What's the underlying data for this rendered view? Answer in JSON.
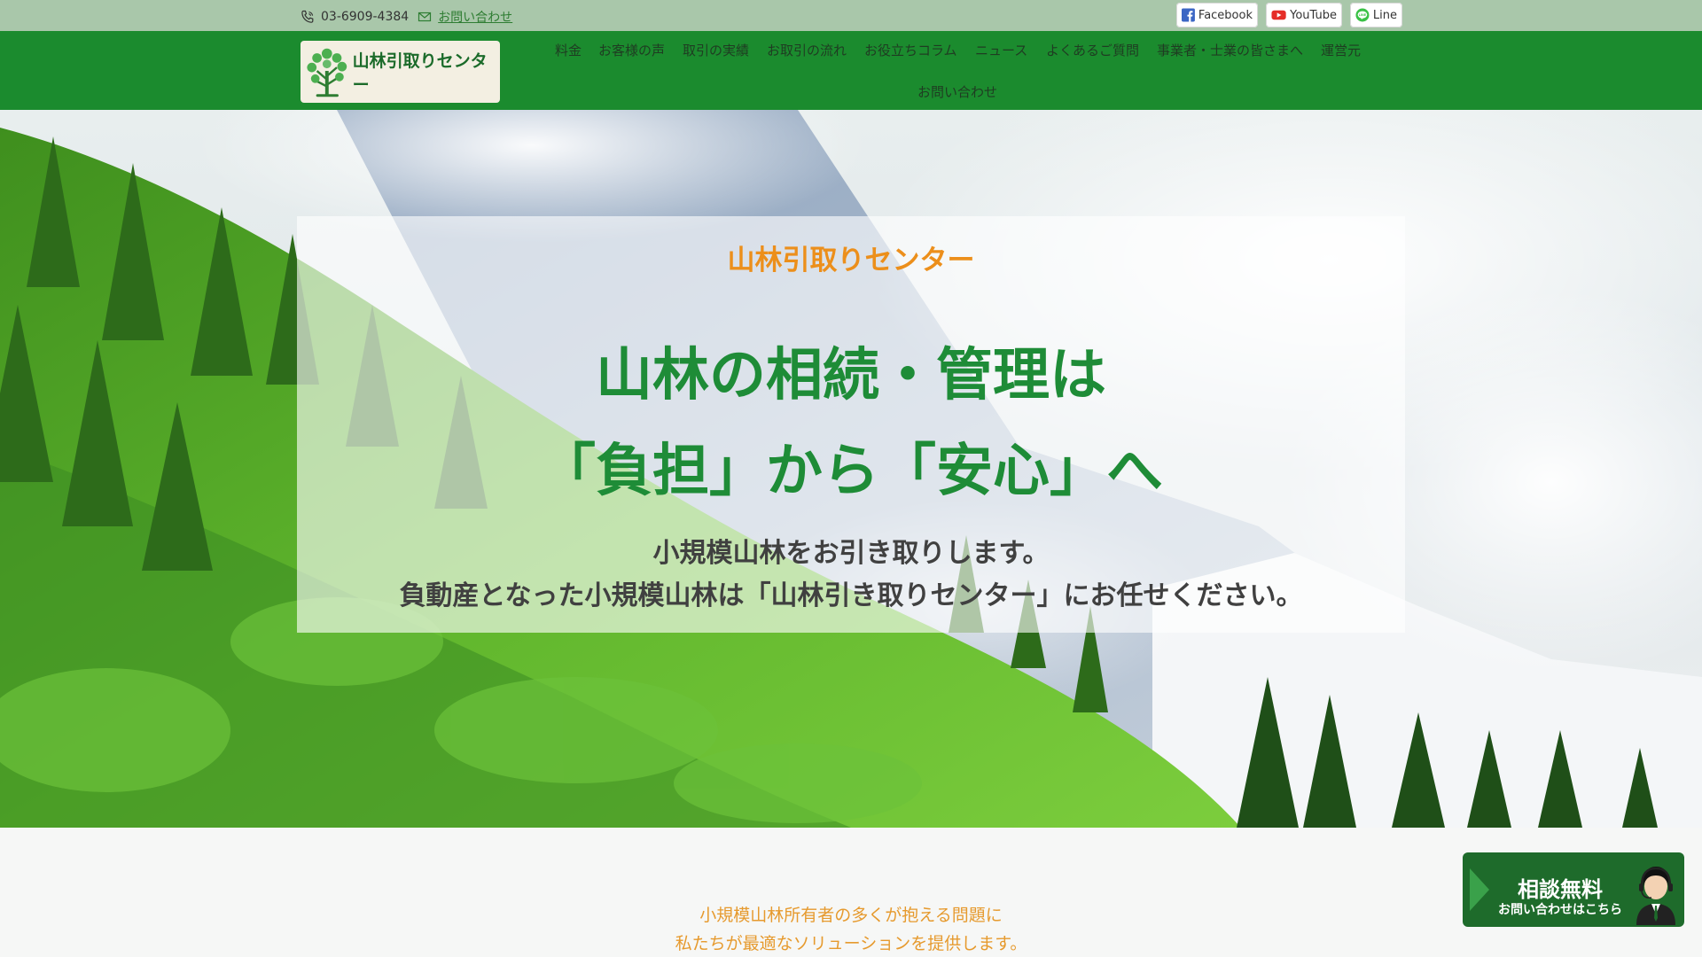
{
  "topbar": {
    "phone": "03-6909-4384",
    "contact_link": "お問い合わせ",
    "social": [
      {
        "label": "Facebook",
        "icon": "facebook-icon"
      },
      {
        "label": "YouTube",
        "icon": "youtube-icon"
      },
      {
        "label": "Line",
        "icon": "line-icon"
      }
    ]
  },
  "header": {
    "logo_text": "山林引取りセンター",
    "nav": [
      {
        "label": "料金"
      },
      {
        "label": "お客様の声"
      },
      {
        "label": "取引の実績"
      },
      {
        "label": "お取引の流れ"
      },
      {
        "label": "お役立ちコラム"
      },
      {
        "label": "ニュース"
      },
      {
        "label": "よくあるご質問"
      },
      {
        "label": "事業者・士業の皆さまへ"
      },
      {
        "label": "運営元"
      },
      {
        "label": "お問い合わせ"
      }
    ]
  },
  "hero": {
    "subtitle": "山林引取りセンター",
    "title_line1": "山林の相続・管理は",
    "title_line2": "「負担」から「安心」へ",
    "desc_line1": "小規模山林をお引き取りします。",
    "desc_line2": "負動産となった小規模山林は「山林引き取りセンター」にお任せください。"
  },
  "intro": {
    "line1": "小規模山林所有者の多くが抱える問題に",
    "line2": "私たちが最適なソリューションを提供します。"
  },
  "consult_banner": {
    "title": "相談無料",
    "subtitle": "お問い合わせはこちら"
  },
  "colors": {
    "header_green": "#1b8b2e",
    "topbar_green": "#a9c7aa",
    "accent_orange": "#ec8f1b",
    "title_green": "#1e8c37"
  }
}
